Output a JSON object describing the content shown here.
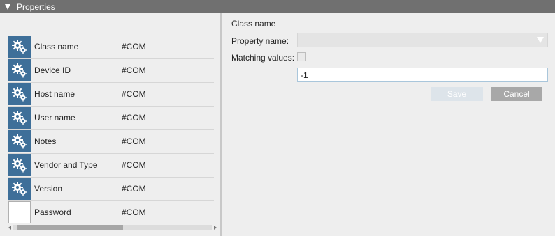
{
  "header": {
    "title": "Properties"
  },
  "properties": [
    {
      "label": "Class name",
      "value": "#COM",
      "icon": "gears-icon"
    },
    {
      "label": "Device ID",
      "value": "#COM",
      "icon": "gears-icon"
    },
    {
      "label": "Host name",
      "value": "#COM",
      "icon": "gears-icon"
    },
    {
      "label": "User name",
      "value": "#COM",
      "icon": "gears-icon"
    },
    {
      "label": "Notes",
      "value": "#COM",
      "icon": "gears-icon"
    },
    {
      "label": "Vendor and Type",
      "value": "#COM",
      "icon": "gears-icon"
    },
    {
      "label": "Version",
      "value": "#COM",
      "icon": "gears-icon"
    },
    {
      "label": "Password",
      "value": "#COM",
      "icon": "blank-icon"
    }
  ],
  "editor": {
    "title": "Class name",
    "property_name_label": "Property name:",
    "property_name_value": "",
    "matching_values_label": "Matching values:",
    "matching_values_checked": false,
    "value_text": "-1",
    "save_label": "Save",
    "cancel_label": "Cancel"
  },
  "scroll": {
    "horizontal_position": 0.5
  },
  "colors": {
    "header": "#707070",
    "icon_bg": "#3e6f99",
    "cancel": "#a8a8a8",
    "save_disabled": "#dde4ea"
  }
}
